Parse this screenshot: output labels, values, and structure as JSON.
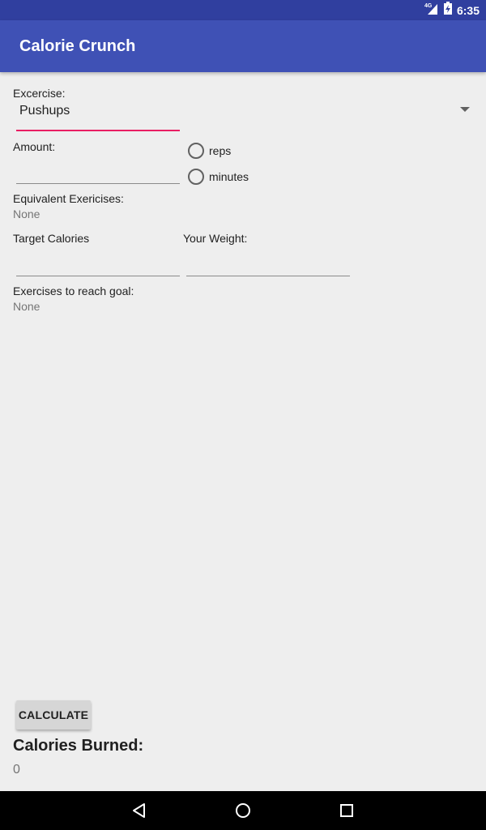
{
  "status_bar": {
    "network": "4G",
    "time": "6:35"
  },
  "app": {
    "title": "Calorie Crunch"
  },
  "form": {
    "exercise_label": "Excercise:",
    "exercise_selected": "Pushups",
    "amount_label": "Amount:",
    "amount_value": "",
    "unit_options": [
      "reps",
      "minutes"
    ],
    "equivalent_label": "Equivalent Exericises:",
    "equivalent_value": "None",
    "target_calories_label": "Target Calories",
    "target_calories_value": "",
    "weight_label": "Your Weight:",
    "weight_value": "",
    "goal_label": "Exercises to reach goal:",
    "goal_value": "None"
  },
  "actions": {
    "calculate_label": "CALCULATE"
  },
  "result": {
    "title": "Calories Burned:",
    "value": "0"
  },
  "nav": {
    "icons": [
      "back-icon",
      "home-icon",
      "recents-icon"
    ]
  },
  "colors": {
    "status_bar": "#303f9f",
    "toolbar": "#3f51b5",
    "accent": "#e91e63",
    "background": "#eeeeee"
  }
}
